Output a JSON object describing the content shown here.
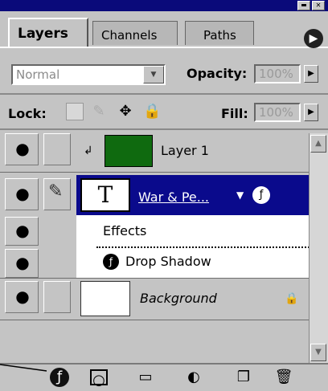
{
  "tabs": {
    "layers": "Layers",
    "channels": "Channels",
    "paths": "Paths"
  },
  "blend_mode": {
    "value": "Normal"
  },
  "opacity": {
    "label": "Opacity:",
    "value": "100%"
  },
  "lock": {
    "label": "Lock:"
  },
  "fill": {
    "label": "Fill:",
    "value": "100%"
  },
  "layers": [
    {
      "name": "Layer 1",
      "visible": true,
      "thumb": "green"
    },
    {
      "name": "War & Pe...",
      "visible": true,
      "selected": true,
      "thumb": "text-T",
      "thumb_char": "T"
    },
    {
      "name": "Background",
      "visible": true,
      "locked": true,
      "thumb": "white"
    }
  ],
  "effects": {
    "label": "Effects",
    "items": [
      "Drop Shadow"
    ]
  },
  "window_buttons": {
    "minimize": "▬",
    "close": "✕"
  },
  "icons": {
    "eye": "eye-icon",
    "brush": "brush-icon",
    "link": "link-icon",
    "fx": "fx-icon",
    "mask": "mask-icon",
    "folder": "folder-icon",
    "adjustment": "adjustment-layer-icon",
    "new_layer": "new-layer-icon",
    "trash": "trash-icon",
    "lock": "lock-icon",
    "menu": "panel-menu-icon"
  },
  "colors": {
    "selection": "#0a0a8c",
    "panel": "#c4c4c4",
    "titlebar": "#0a0a7a",
    "layer1_thumb": "#0f6a0f"
  }
}
